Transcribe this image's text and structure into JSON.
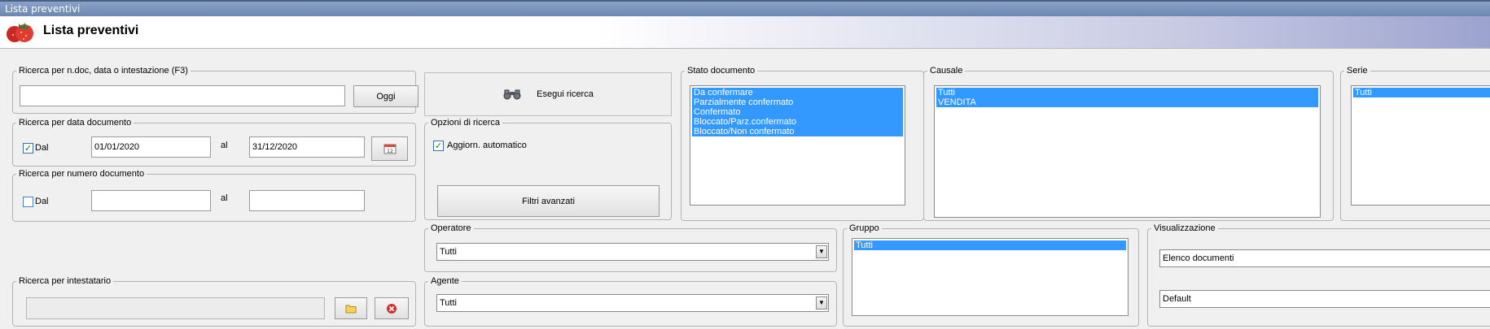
{
  "window": {
    "title": "Lista preventivi"
  },
  "header": {
    "title": "Lista preventivi",
    "icon": "strawberry-icon"
  },
  "search_main": {
    "legend": "Ricerca per n.doc, data o intestazione (F3)",
    "value": "",
    "today_label": "Oggi"
  },
  "search_date": {
    "legend": "Ricerca per data documento",
    "from_label": "Dal",
    "from_checked": true,
    "from_value": "01/01/2020",
    "to_label": "al",
    "to_value": "31/12/2020"
  },
  "search_number": {
    "legend": "Ricerca per numero documento",
    "from_label": "Dal",
    "from_checked": false,
    "from_value": "",
    "to_label": "al",
    "to_value": ""
  },
  "search_holder": {
    "legend": "Ricerca per intestatario",
    "value": ""
  },
  "run_search": {
    "label": "Esegui ricerca",
    "icon": "binoculars-icon"
  },
  "options": {
    "legend": "Opzioni di ricerca",
    "auto_update_label": "Aggiorn. automatico",
    "auto_update_checked": true,
    "advanced_filters_label": "Filtri avanzati"
  },
  "operator": {
    "legend": "Operatore",
    "value": "Tutti"
  },
  "agent": {
    "legend": "Agente",
    "value": "Tutti"
  },
  "doc_state": {
    "legend": "Stato documento",
    "items": [
      "Da confermare",
      "Parzialmente confermato",
      "Confermato",
      "Bloccato/Parz.confermato",
      "Bloccato/Non confermato"
    ]
  },
  "causale": {
    "legend": "Causale",
    "items": [
      "Tutti",
      "VENDITA"
    ]
  },
  "serie": {
    "legend": "Serie",
    "items": [
      "Tutti"
    ]
  },
  "gruppo": {
    "legend": "Gruppo",
    "items": [
      "Tutti"
    ]
  },
  "display": {
    "legend": "Visualizzazione",
    "view_value": "Elenco documenti",
    "layout_value": "Default"
  },
  "colors": {
    "selection": "#3399ff",
    "titlebar": "#6c87b3"
  }
}
